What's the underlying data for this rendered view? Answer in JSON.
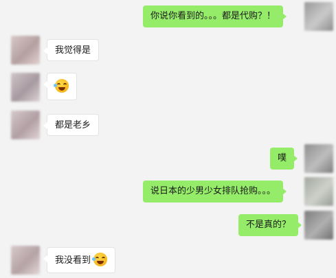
{
  "colors": {
    "sent_bubble": "#95ec69",
    "received_bubble": "#ffffff",
    "background": "#f3f3f3"
  },
  "messages": [
    {
      "side": "right",
      "text": "你说你看到的。。。都是代购？！"
    },
    {
      "side": "left",
      "text": "我觉得是"
    },
    {
      "side": "left",
      "text": "",
      "icon": "laughing-tears-emoji-icon"
    },
    {
      "side": "left",
      "text": "都是老乡"
    },
    {
      "side": "right",
      "text": "噗"
    },
    {
      "side": "right",
      "text": "说日本的少男少女排队抢购。。。"
    },
    {
      "side": "right",
      "text": "不是真的？"
    },
    {
      "side": "left",
      "text": "我没看到",
      "icon": "laughing-tears-emoji-icon"
    }
  ]
}
